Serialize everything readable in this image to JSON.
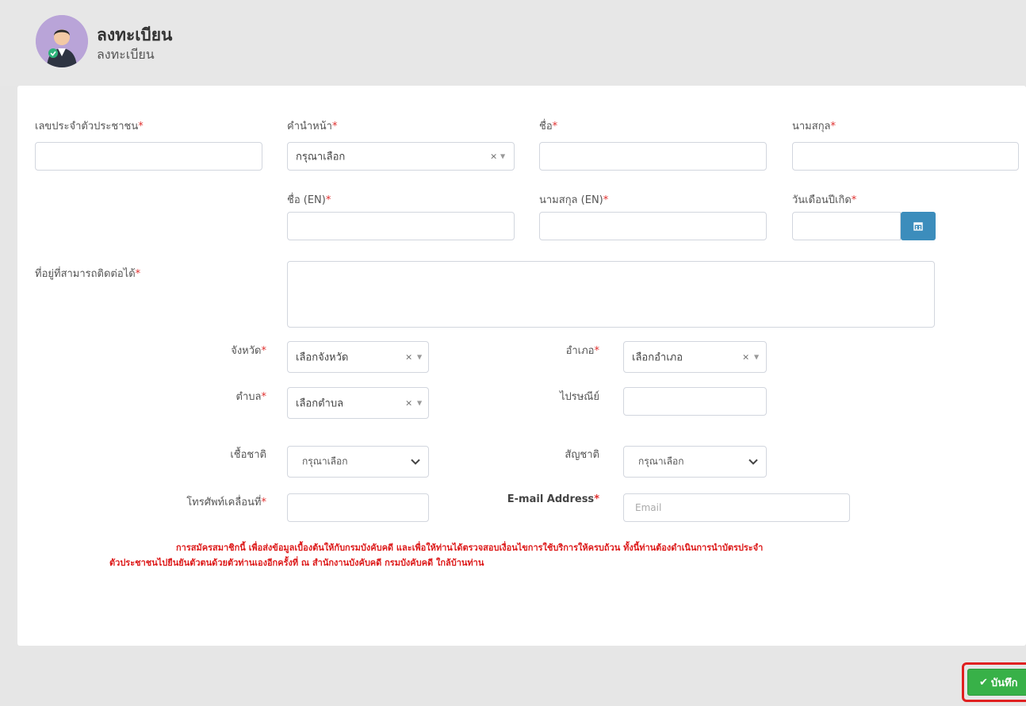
{
  "header": {
    "title": "ลงทะเบียน",
    "subtitle": "ลงทะเบียน"
  },
  "form": {
    "id_card_label": "เลขประจำตัวประชาชน",
    "prefix_label": "คำนำหน้า",
    "prefix_value": "กรุณาเลือก",
    "first_name_label": "ชื่อ",
    "last_name_label": "นามสกุล",
    "first_name_en_label": "ชื่อ (EN)",
    "last_name_en_label": "นามสกุล (EN)",
    "birthdate_label": "วันเดือนปีเกิด",
    "address_label": "ที่อยู่ที่สามารถติดต่อได้",
    "province_label": "จังหวัด",
    "province_value": "เลือกจังหวัด",
    "district_label": "อำเภอ",
    "district_value": "เลือกอำเภอ",
    "subdistrict_label": "ตำบล",
    "subdistrict_value": "เลือกตำบล",
    "postcode_label": "ไปรษณีย์",
    "race_label": "เชื้อชาติ",
    "race_value": "กรุณาเลือก",
    "nationality_label": "สัญชาติ",
    "nationality_value": "กรุณาเลือก",
    "mobile_label": "โทรศัพท์เคลื่อนที่",
    "email_label": "E-mail Address",
    "email_placeholder": "Email",
    "required_mark": "*",
    "clear_symbol": "×",
    "arrow_symbol": "▼"
  },
  "notice": {
    "line1": "การสมัครสมาชิกนี้ เพื่อส่งข้อมูลเบื้องต้นให้กับกรมบังคับคดี และเพื่อให้ท่านได้ตรวจสอบเงื่อนไขการใช้บริการให้ครบถ้วน ทั้งนี้ท่านต้องดำเนินการนำบัตรประจำ",
    "line2": "ตัวประชาชนไปยืนยันตัวตนด้วยตัวท่านเองอีกครั้งที่ ณ สำนักงานบังคับคดี กรมบังคับคดี ใกล้บ้านท่าน"
  },
  "actions": {
    "save_label": "บันทึก",
    "save_icon": "✔"
  },
  "colors": {
    "required": "#e0302f",
    "notice": "#dd1b1b",
    "save_button": "#38b148",
    "highlight_border": "#e02020",
    "calendar_button": "#3c8dbc"
  }
}
